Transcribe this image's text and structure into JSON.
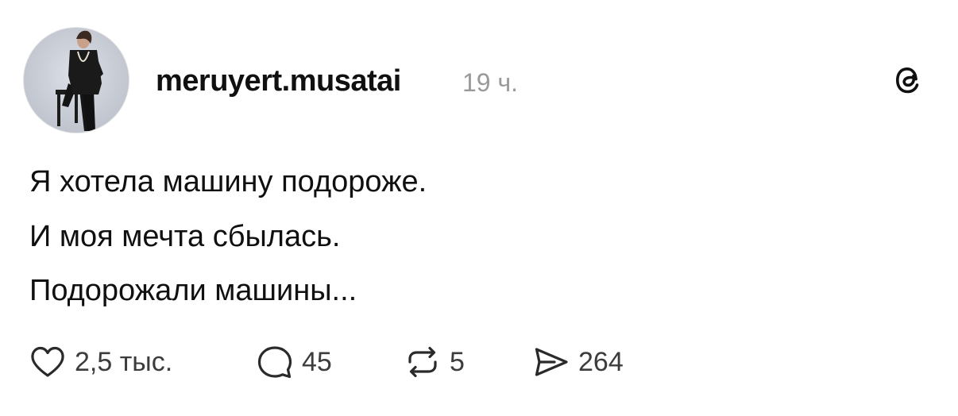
{
  "post": {
    "username": "meruyert.musatai",
    "timestamp": "19 ч.",
    "text_lines": [
      "Я хотела машину подороже.",
      "И моя мечта сбылась.",
      "Подорожали машины..."
    ],
    "actions": {
      "likes": "2,5 тыс.",
      "replies": "45",
      "reposts": "5",
      "shares": "264"
    }
  },
  "icons": {
    "avatar": "profile-photo",
    "logo": "threads-logo-icon",
    "like": "heart-icon",
    "reply": "comment-bubble-icon",
    "repost": "repost-arrows-icon",
    "share": "send-plane-icon"
  },
  "colors": {
    "text": "#101010",
    "muted": "#9a9a9a",
    "count": "#3c3c3c",
    "background": "#ffffff"
  }
}
